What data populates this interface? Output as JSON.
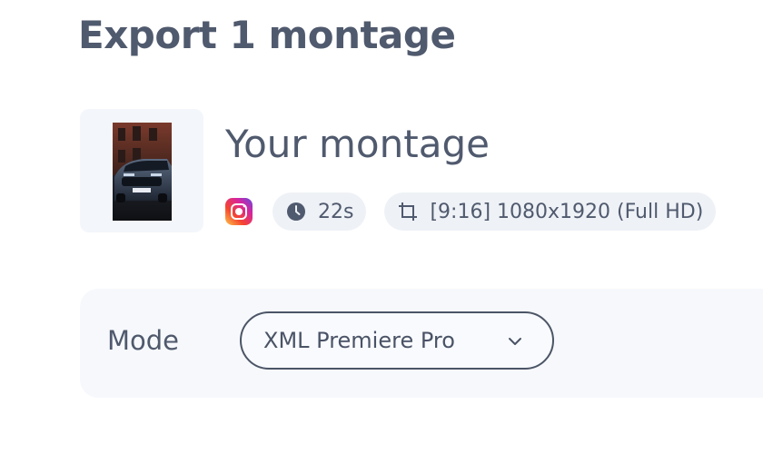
{
  "header": {
    "title": "Export 1 montage"
  },
  "montage": {
    "thumbnail_icon": "car-video-thumbnail",
    "name": "Your montage",
    "platform_icon": "instagram-icon",
    "duration_icon": "clock-icon",
    "duration": "22s",
    "format_icon": "crop-icon",
    "format": "[9:16] 1080x1920 (Full HD)"
  },
  "mode": {
    "label": "Mode",
    "selected": "XML Premiere Pro",
    "chevron_icon": "chevron-down-icon"
  },
  "colors": {
    "text": "#505a6e",
    "pill_bg": "#eef1f6",
    "panel_bg": "#f6f8fc",
    "select_border": "#4c5566"
  }
}
